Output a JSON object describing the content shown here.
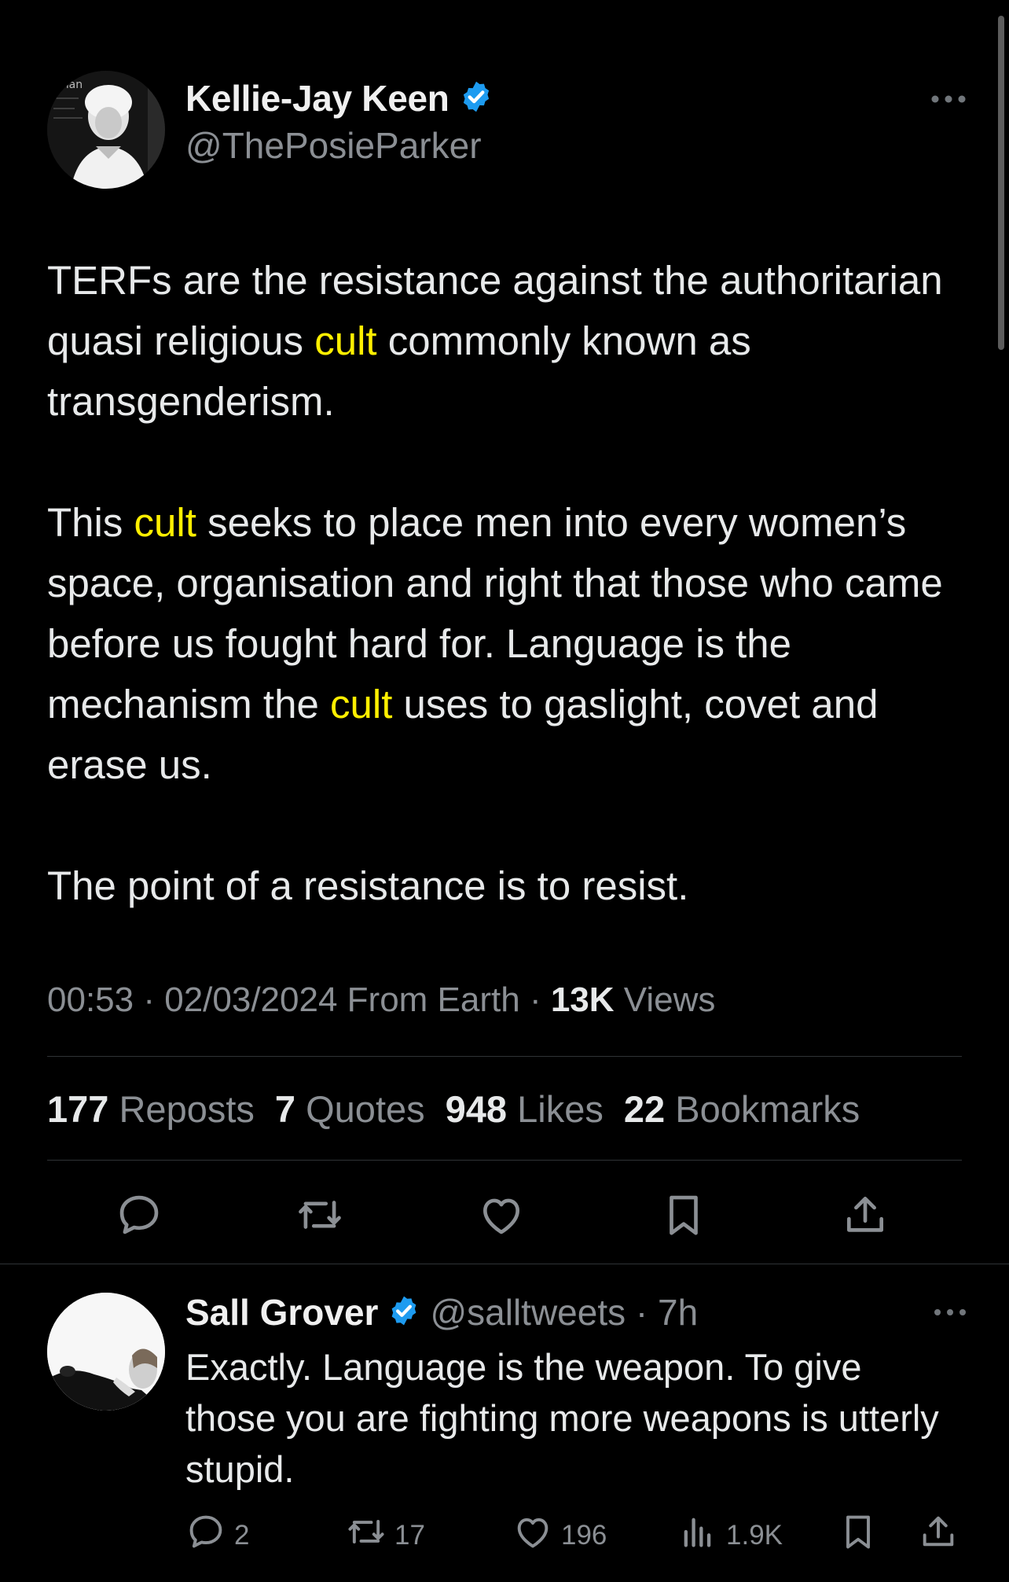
{
  "main_tweet": {
    "display_name": "Kellie-Jay Keen",
    "handle": "@ThePosieParker",
    "avatar_text": "man",
    "paragraphs": [
      [
        {
          "text": "TERFs are the resistance against the authoritarian quasi religious ",
          "highlight": false
        },
        {
          "text": "cult",
          "highlight": true
        },
        {
          "text": " commonly known as transgenderism.",
          "highlight": false
        }
      ],
      [
        {
          "text": "This ",
          "highlight": false
        },
        {
          "text": "cult",
          "highlight": true
        },
        {
          "text": " seeks to place men into every women’s space, organisation and right that those who came before us fought hard for. Language is the mechanism the ",
          "highlight": false
        },
        {
          "text": "cult",
          "highlight": true
        },
        {
          "text": " uses to gaslight, covet and erase us.",
          "highlight": false
        }
      ],
      [
        {
          "text": "The point of a resistance is to resist.",
          "highlight": false
        }
      ]
    ],
    "meta": {
      "time": "00:53",
      "date": "02/03/2024",
      "source": "From Earth",
      "views_count": "13K",
      "views_label": "Views"
    },
    "stats": {
      "reposts_count": "177",
      "reposts_label": "Reposts",
      "quotes_count": "7",
      "quotes_label": "Quotes",
      "likes_count": "948",
      "likes_label": "Likes",
      "bookmarks_count": "22",
      "bookmarks_label": "Bookmarks"
    }
  },
  "reply": {
    "display_name": "Sall Grover",
    "handle": "@salltweets",
    "time": "7h",
    "text": "Exactly. Language is the weapon. To give those you are fighting more weapons is utterly stupid.",
    "counts": {
      "replies": "2",
      "reposts": "17",
      "likes": "196",
      "views": "1.9K"
    }
  },
  "colors": {
    "background": "#000000",
    "text": "#e7e9ea",
    "muted": "#8b8f94",
    "highlight": "#ffef00",
    "verified": "#1d9bf0",
    "divider": "#2f3336"
  },
  "icons": [
    "verified-badge-icon",
    "more-icon",
    "reply-icon",
    "repost-icon",
    "like-icon",
    "bookmark-icon",
    "share-icon",
    "views-icon"
  ]
}
